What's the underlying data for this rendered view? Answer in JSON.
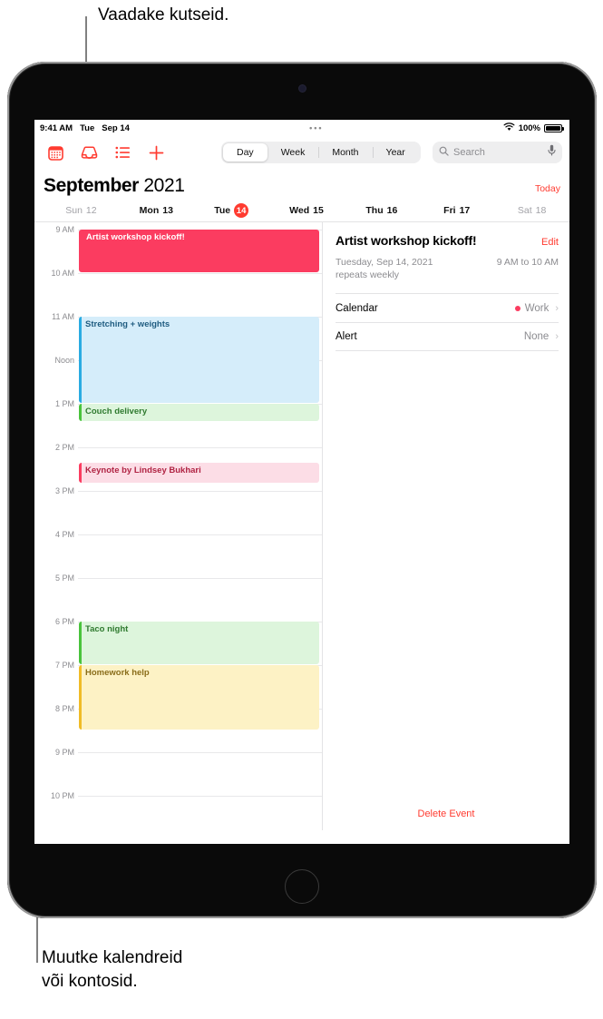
{
  "callouts": {
    "top": "Vaadake kutseid.",
    "bottom": "Muutke kalendreid\nvõi kontosid."
  },
  "status_bar": {
    "time": "9:41 AM",
    "weekday": "Tue",
    "date": "Sep 14",
    "dots": "•••",
    "wifi_icon": "wifi-icon",
    "battery_percent": "100%",
    "battery_icon": "battery-icon"
  },
  "toolbar": {
    "icons": [
      {
        "name": "calendars-icon",
        "label": "Calendars"
      },
      {
        "name": "inbox-icon",
        "label": "Inbox"
      },
      {
        "name": "list-icon",
        "label": "List"
      },
      {
        "name": "add-event-icon",
        "label": "Add Event"
      }
    ],
    "segments": [
      {
        "label": "Day",
        "active": true
      },
      {
        "label": "Week",
        "active": false
      },
      {
        "label": "Month",
        "active": false
      },
      {
        "label": "Year",
        "active": false
      }
    ],
    "search": {
      "placeholder": "Search",
      "value": "",
      "search_icon": "search-icon",
      "mic_icon": "microphone-icon"
    }
  },
  "header": {
    "month": "September",
    "year": "2021",
    "today_label": "Today"
  },
  "weekdays": [
    {
      "label": "Sun",
      "day": "12",
      "dim": true,
      "selected": false
    },
    {
      "label": "Mon",
      "day": "13",
      "dim": false,
      "selected": false
    },
    {
      "label": "Tue",
      "day": "14",
      "dim": false,
      "selected": true
    },
    {
      "label": "Wed",
      "day": "15",
      "dim": false,
      "selected": false
    },
    {
      "label": "Thu",
      "day": "16",
      "dim": false,
      "selected": false
    },
    {
      "label": "Fri",
      "day": "17",
      "dim": false,
      "selected": false
    },
    {
      "label": "Sat",
      "day": "18",
      "dim": true,
      "selected": false
    }
  ],
  "day_view": {
    "hours": [
      "9 AM",
      "10 AM",
      "11 AM",
      "Noon",
      "1 PM",
      "2 PM",
      "3 PM",
      "4 PM",
      "5 PM",
      "6 PM",
      "7 PM",
      "8 PM",
      "9 PM",
      "10 PM"
    ],
    "events": [
      {
        "title": "Artist workshop kickoff!",
        "start_hour_index": 0,
        "duration_hours": 1,
        "bg": "#fb3c60",
        "text_color": "#ffffff",
        "bar_color": "#fb3c60",
        "selected": true
      },
      {
        "title": "Stretching + weights",
        "start_hour_index": 2,
        "duration_hours": 2,
        "bg": "#d5edfa",
        "text_color": "#1f5c80",
        "bar_color": "#2aabe2",
        "selected": false
      },
      {
        "title": "Couch delivery",
        "start_hour_index": 4,
        "duration_hours": 0.42,
        "bg": "#ddf5dc",
        "text_color": "#2f7a2f",
        "bar_color": "#49c33c",
        "selected": false
      },
      {
        "title": "Keynote by Lindsey Bukhari",
        "start_hour_index": 5.35,
        "duration_hours": 0.48,
        "bg": "#fcdde6",
        "text_color": "#b02343",
        "bar_color": "#fb3c60",
        "selected": false
      },
      {
        "title": "Taco night",
        "start_hour_index": 9,
        "duration_hours": 1,
        "bg": "#ddf5dc",
        "text_color": "#2f7a2f",
        "bar_color": "#49c33c",
        "selected": false
      },
      {
        "title": "Homework help",
        "start_hour_index": 10,
        "duration_hours": 1.5,
        "bg": "#fdf2c5",
        "text_color": "#8a6d1a",
        "bar_color": "#f0bc27",
        "selected": false
      }
    ]
  },
  "detail": {
    "title": "Artist workshop kickoff!",
    "edit_label": "Edit",
    "date": "Tuesday, Sep 14, 2021",
    "time_range": "9 AM to 10 AM",
    "repeat": "repeats weekly",
    "rows": [
      {
        "label": "Calendar",
        "value": "Work",
        "dot_color": "#fb3c60",
        "chevron": "›"
      },
      {
        "label": "Alert",
        "value": "None",
        "dot_color": "",
        "chevron": "›"
      }
    ],
    "delete_label": "Delete Event"
  },
  "colors": {
    "accent": "#ff3b30",
    "selected_event": "#fb3c60",
    "grid_line": "#e8e8ea",
    "muted_text": "#8c8c90"
  }
}
